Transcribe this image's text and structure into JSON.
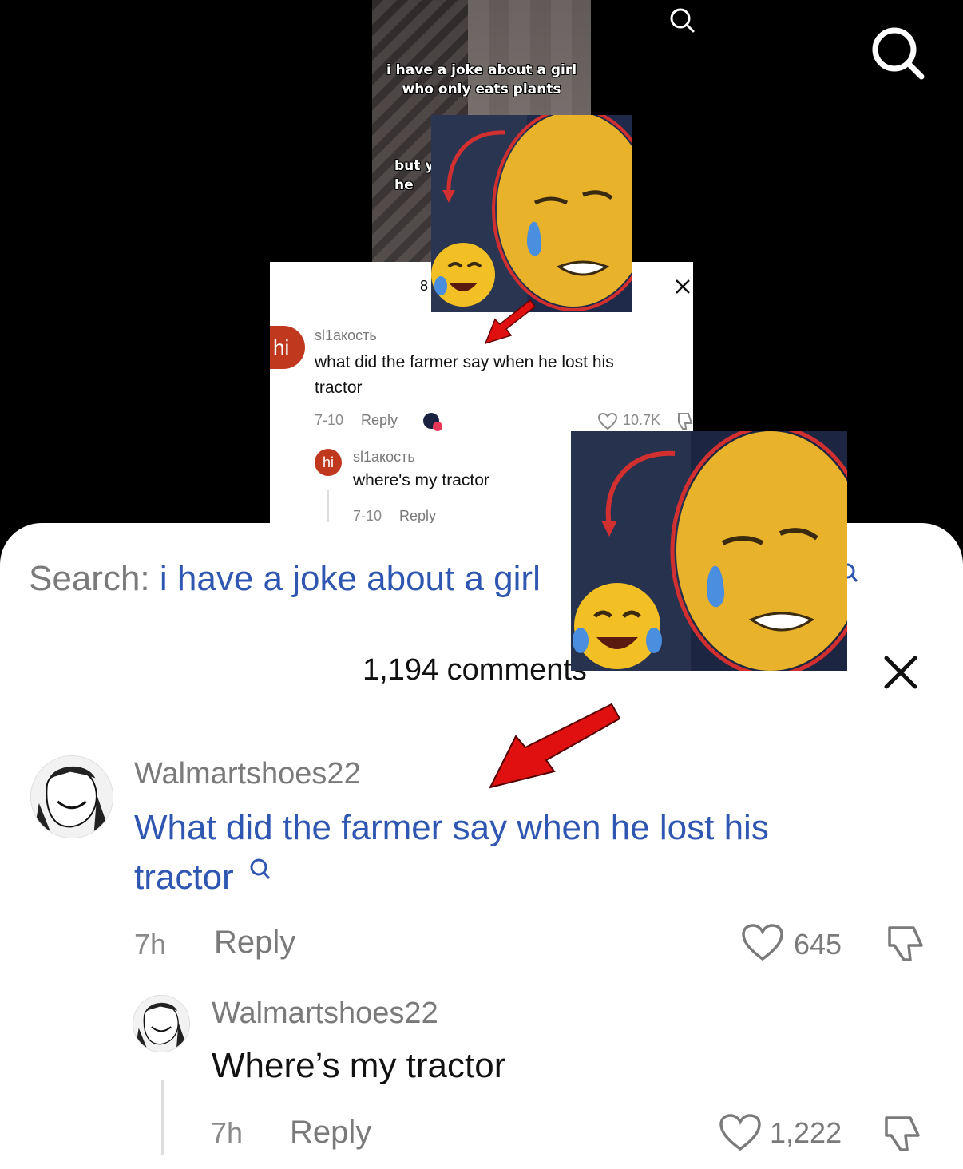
{
  "video": {
    "caption_top": "i have a joke about a girl who only eats plants",
    "caption_bottom": "but y he"
  },
  "small_panel": {
    "count": "8",
    "comment": {
      "avatar_text": "hi",
      "user": "sl1акость",
      "text": "what did the farmer say when he lost his tractor",
      "date": "7-10",
      "reply": "Reply",
      "likes": "10.7K"
    },
    "reply_comment": {
      "avatar_text": "hi",
      "user": "sl1акость",
      "text": "where's my tractor",
      "date": "7-10",
      "reply": "Reply"
    }
  },
  "search": {
    "label": "Search:",
    "query": "i have a joke about a girl"
  },
  "header": {
    "comments_count": "1,194 comments"
  },
  "comments": [
    {
      "user": "Walmartshoes22",
      "text": "What did the farmer say when he lost his tractor",
      "time": "7h",
      "reply": "Reply",
      "likes": "645"
    }
  ],
  "replies": [
    {
      "user": "Walmartshoes22",
      "text": "Where’s my tractor",
      "time": "7h",
      "reply": "Reply",
      "likes": "1,222"
    }
  ],
  "colors": {
    "link": "#2f56b0",
    "muted": "#7a7a7a",
    "arrow": "#e01010",
    "avatar_hi": "#c0391f"
  },
  "icons": [
    "search-icon",
    "close-icon",
    "heart-icon",
    "dislike-icon",
    "arrow-icon"
  ]
}
